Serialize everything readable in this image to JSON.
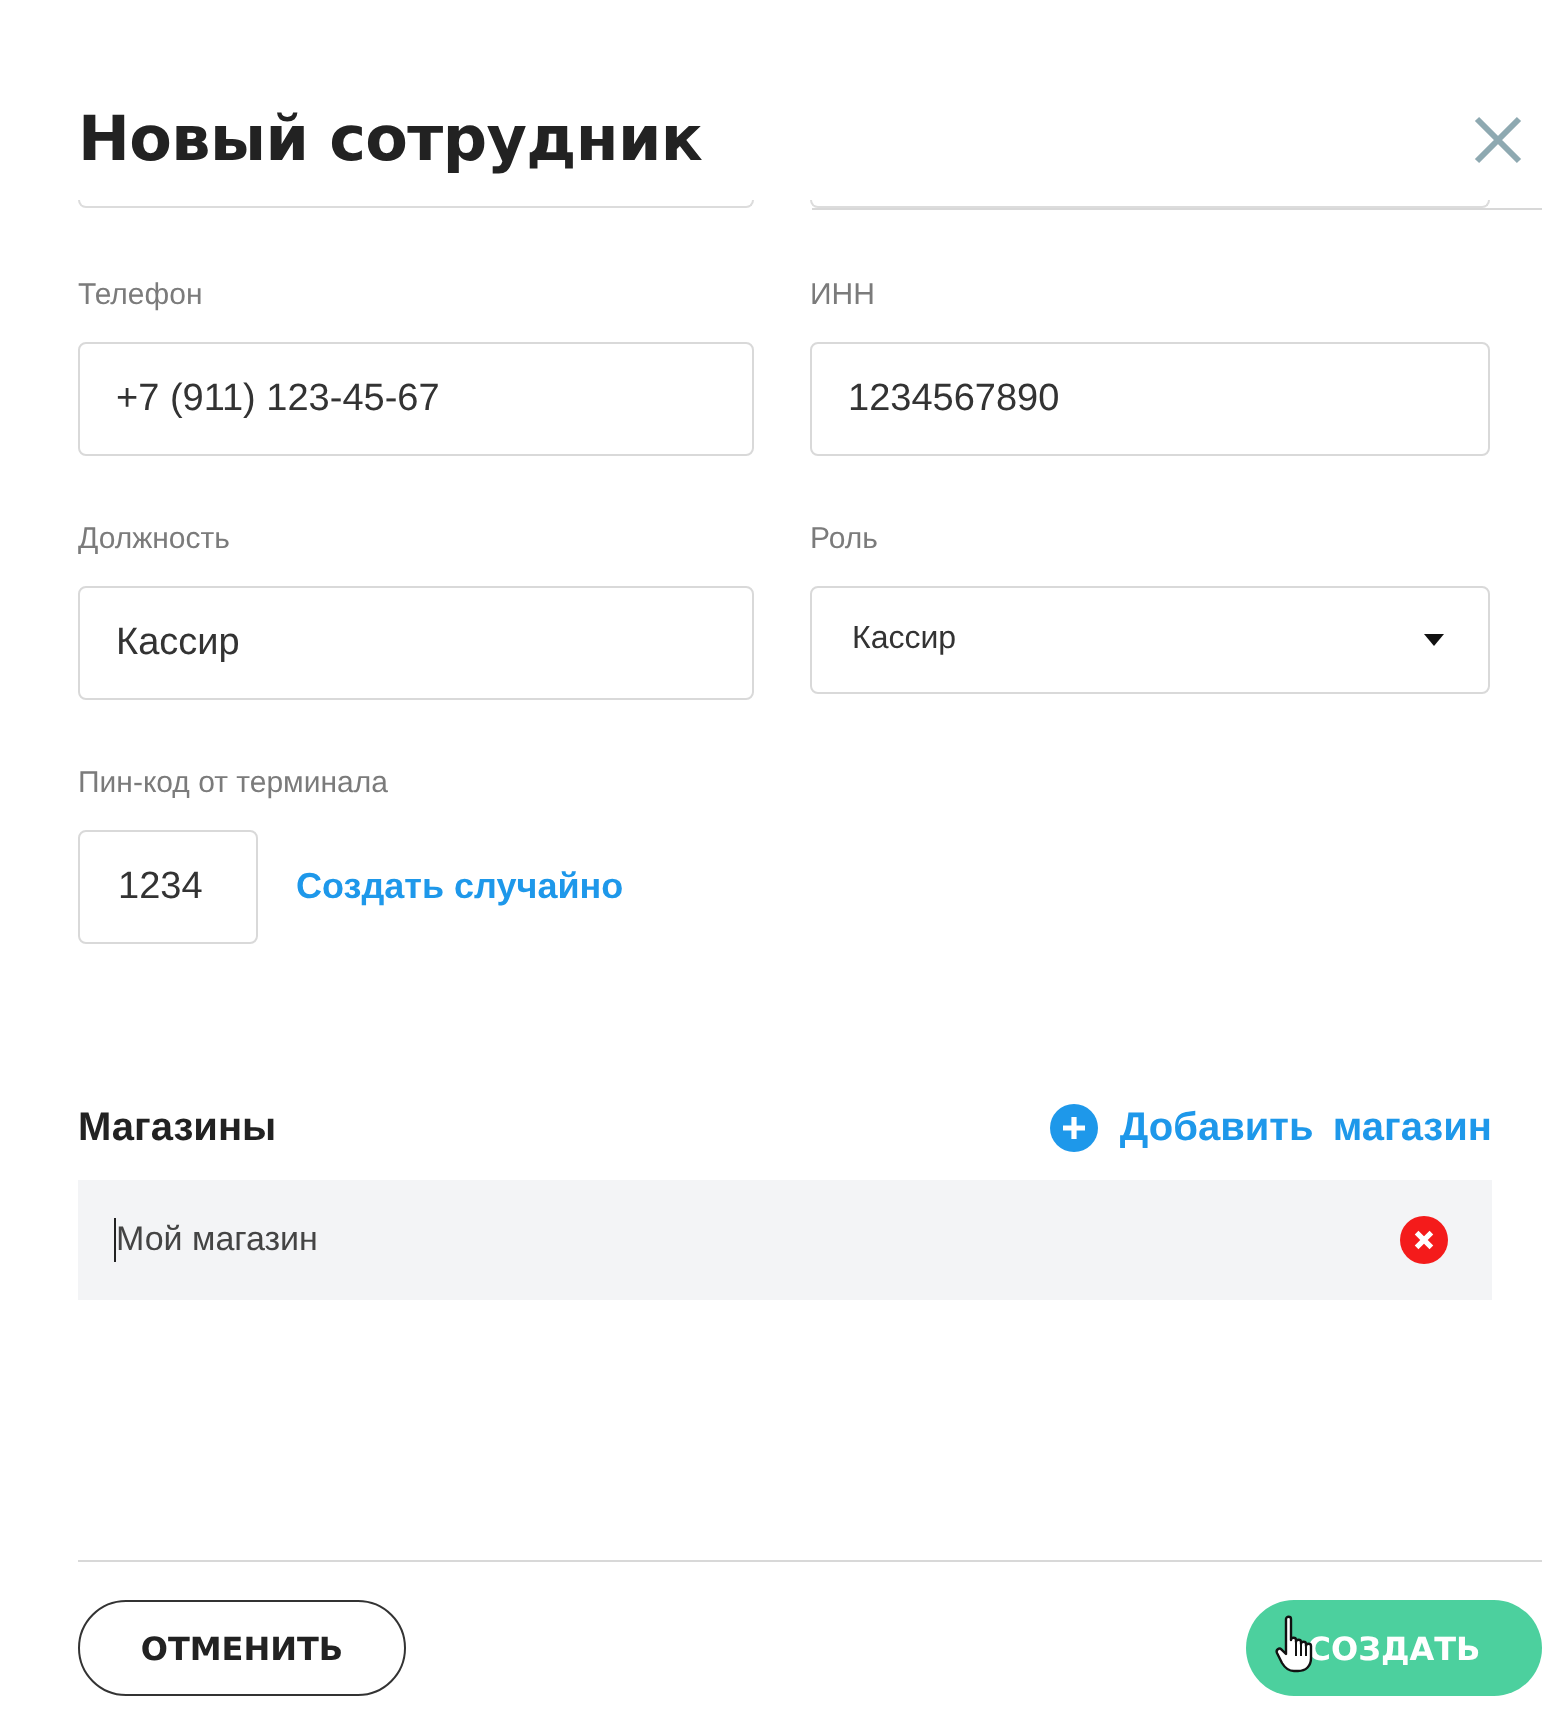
{
  "dialog": {
    "title": "Новый сотрудник"
  },
  "fields": [
    {
      "kind": "input",
      "label": "Телефон",
      "value": "+7 (911) 123-45-67"
    },
    {
      "kind": "input",
      "label": "ИНН",
      "value": "1234567890"
    },
    {
      "kind": "input",
      "label": "Должность",
      "value": "Кассир"
    },
    {
      "kind": "select",
      "label": "Роль",
      "value": "Кассир"
    }
  ],
  "pin": {
    "label": "Пин-код от терминала",
    "value": "1234",
    "generate_link": "Создать случайно"
  },
  "stores": {
    "heading": "Магазины",
    "add_link": "Добавить магазин",
    "items": [
      {
        "name": "Мой магазин",
        "focused": true
      }
    ]
  },
  "footer": {
    "buttons": [
      {
        "label": "ОТМЕНИТЬ",
        "kind": "outline",
        "hovered": false
      },
      {
        "label": "СОЗДАТЬ",
        "kind": "primary",
        "hovered": true
      }
    ]
  }
}
